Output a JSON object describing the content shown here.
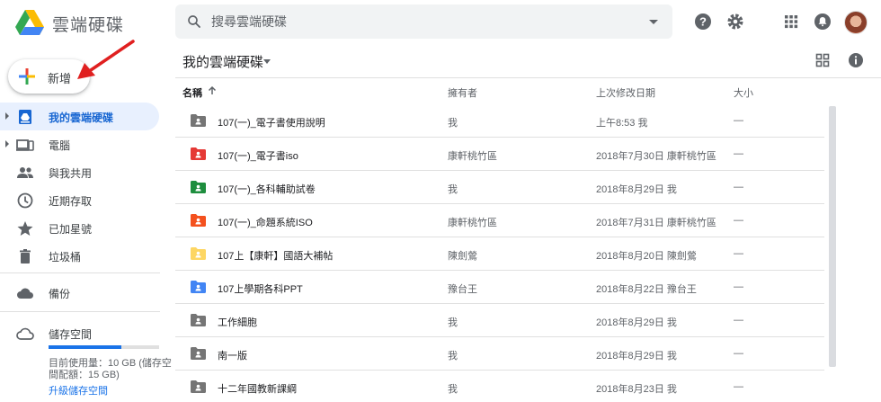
{
  "app": {
    "title": "雲端硬碟"
  },
  "search": {
    "placeholder": "搜尋雲端硬碟"
  },
  "toolbar": {
    "icons": [
      "help-icon",
      "settings-icon",
      "apps-grid-icon",
      "notifications-icon",
      "account-avatar"
    ]
  },
  "new_button": {
    "label": "新增"
  },
  "sidebar": {
    "items": [
      {
        "label": "我的雲端硬碟",
        "icon": "my-drive-icon",
        "active": true,
        "expandable": true
      },
      {
        "label": "電腦",
        "icon": "computers-icon",
        "active": false,
        "expandable": true
      },
      {
        "label": "與我共用",
        "icon": "shared-people-icon",
        "active": false,
        "expandable": false
      },
      {
        "label": "近期存取",
        "icon": "clock-icon",
        "active": false,
        "expandable": false
      },
      {
        "label": "已加星號",
        "icon": "star-icon",
        "active": false,
        "expandable": false
      },
      {
        "label": "垃圾桶",
        "icon": "trash-icon",
        "active": false,
        "expandable": false
      }
    ],
    "backup": {
      "label": "備份",
      "icon": "cloud-filled-icon"
    },
    "storage": {
      "label": "儲存空間",
      "icon": "cloud-outline-icon",
      "used_fraction": 0.66,
      "usage_line1": "目前使用量：10 GB (儲存空",
      "usage_line2": "間配額：15 GB)",
      "upgrade": "升級儲存空間"
    }
  },
  "main": {
    "breadcrumb": "我的雲端硬碟",
    "view_icons": [
      "grid-view-icon",
      "info-icon"
    ],
    "columns": {
      "name": "名稱",
      "owner": "擁有者",
      "modified": "上次修改日期",
      "size": "大小"
    },
    "rows": [
      {
        "name": "107(一)_電子書使用說明",
        "owner": "我",
        "modified": "上午8:53 我",
        "size": "—",
        "color": "#757575"
      },
      {
        "name": "107(一)_電子書iso",
        "owner": "康軒桃竹區",
        "modified": "2018年7月30日 康軒桃竹區",
        "size": "—",
        "color": "#e53935"
      },
      {
        "name": "107(一)_各科輔助試卷",
        "owner": "我",
        "modified": "2018年8月29日 我",
        "size": "—",
        "color": "#1e8e3e"
      },
      {
        "name": "107(一)_命題系統ISO",
        "owner": "康軒桃竹區",
        "modified": "2018年7月31日 康軒桃竹區",
        "size": "—",
        "color": "#f4511e"
      },
      {
        "name": "107上【康軒】國語大補帖",
        "owner": "陳劍鶯",
        "modified": "2018年8月20日 陳劍鶯",
        "size": "—",
        "color": "#fdd663"
      },
      {
        "name": "107上學期各科PPT",
        "owner": "豫台王",
        "modified": "2018年8月22日 豫台王",
        "size": "—",
        "color": "#4285f4"
      },
      {
        "name": "工作細胞",
        "owner": "我",
        "modified": "2018年8月29日 我",
        "size": "—",
        "color": "#757575"
      },
      {
        "name": "南一版",
        "owner": "我",
        "modified": "2018年8月29日 我",
        "size": "—",
        "color": "#757575"
      },
      {
        "name": "十二年國教新課綱",
        "owner": "我",
        "modified": "2018年8月23日 我",
        "size": "—",
        "color": "#757575"
      }
    ]
  }
}
